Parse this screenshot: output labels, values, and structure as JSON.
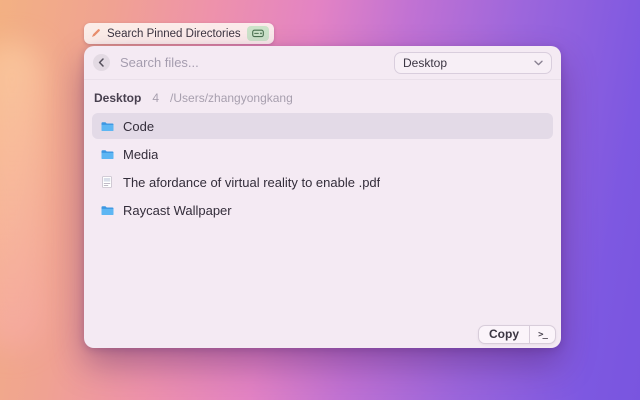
{
  "tooltip": {
    "label": "Search Pinned Directories",
    "left_icon": "pencil-icon",
    "right_icon": "drive-icon"
  },
  "window": {
    "header": {
      "back_glyph": "chevron-left",
      "search_placeholder": "Search files...",
      "dropdown_value": "Desktop"
    },
    "breadcrumb": {
      "section": "Desktop",
      "count": "4",
      "path": "/Users/zhangyongkang"
    },
    "list": [
      {
        "label": "Code",
        "icon": "folder",
        "selected": true
      },
      {
        "label": "Media",
        "icon": "folder",
        "selected": false
      },
      {
        "label": "The afordance of virtual reality to enable .pdf",
        "icon": "pdf",
        "selected": false
      },
      {
        "label": "Raycast Wallpaper",
        "icon": "folder",
        "selected": false
      }
    ],
    "footer": {
      "copy_label": "Copy",
      "terminal_label": ">_"
    }
  },
  "colors": {
    "accent_folder_blue": "#4aa6ee",
    "selected_row": "#e3dae7",
    "window_bg": "#f4eaf3",
    "pill_green": "#cde4ca",
    "gradient_start": "#f3b183",
    "gradient_mid": "#e383c4",
    "gradient_end": "#7955df"
  }
}
